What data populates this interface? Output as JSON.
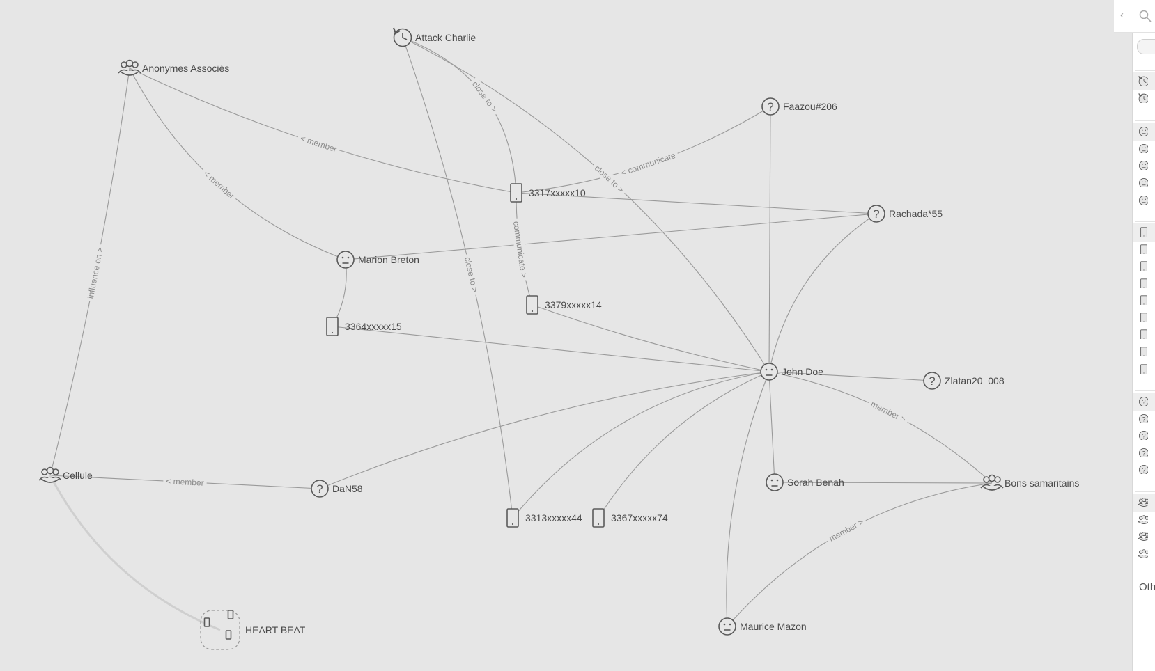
{
  "graph": {
    "nodes": [
      {
        "id": "attack",
        "label": "Attack Charlie",
        "icon": "history-clock-icon"
      },
      {
        "id": "anon",
        "label": "Anonymes Associés",
        "icon": "group-icon"
      },
      {
        "id": "faazou",
        "label": "Faazou#206",
        "icon": "question-icon"
      },
      {
        "id": "p3317",
        "label": "3317xxxxx10",
        "icon": "phone-icon"
      },
      {
        "id": "rachada",
        "label": "Rachada*55",
        "icon": "question-icon"
      },
      {
        "id": "marion",
        "label": "Marion Breton",
        "icon": "person-face-icon"
      },
      {
        "id": "p3379",
        "label": "3379xxxxx14",
        "icon": "phone-icon"
      },
      {
        "id": "p3364",
        "label": "3364xxxxx15",
        "icon": "phone-icon"
      },
      {
        "id": "john",
        "label": "John Doe",
        "icon": "person-face-icon"
      },
      {
        "id": "zlatan",
        "label": "Zlatan20_008",
        "icon": "question-icon"
      },
      {
        "id": "cellule",
        "label": "Cellule",
        "icon": "group-icon"
      },
      {
        "id": "dan",
        "label": "DaN58",
        "icon": "question-icon"
      },
      {
        "id": "sorah",
        "label": "Sorah Benah",
        "icon": "person-face-icon"
      },
      {
        "id": "bons",
        "label": "Bons samaritains",
        "icon": "group-icon"
      },
      {
        "id": "p3313",
        "label": "3313xxxxx44",
        "icon": "phone-icon"
      },
      {
        "id": "p3367",
        "label": "3367xxxxx74",
        "icon": "phone-icon"
      },
      {
        "id": "heart",
        "label": "HEART BEAT",
        "icon": "phone-cluster-icon"
      },
      {
        "id": "maurice",
        "label": "Maurice Mazon",
        "icon": "person-face-icon"
      }
    ],
    "edges": [
      {
        "from": "p3317",
        "to": "anon",
        "label": "< member"
      },
      {
        "from": "marion",
        "to": "anon",
        "label": "< member"
      },
      {
        "from": "cellule",
        "to": "anon",
        "label": "influence on >"
      },
      {
        "from": "attack",
        "to": "p3317",
        "label": "close to >"
      },
      {
        "from": "p3317",
        "to": "faazou",
        "label": "< communicate"
      },
      {
        "from": "p3317",
        "to": "p3379",
        "label": "communicate >"
      },
      {
        "from": "attack",
        "to": "john",
        "label": "close to >"
      },
      {
        "from": "attack",
        "to": "p3313",
        "label": "close to >"
      },
      {
        "from": "p3317",
        "to": "rachada",
        "label": ""
      },
      {
        "from": "marion",
        "to": "rachada",
        "label": ""
      },
      {
        "from": "marion",
        "to": "p3364",
        "label": ""
      },
      {
        "from": "faazou",
        "to": "john",
        "label": ""
      },
      {
        "from": "rachada",
        "to": "john",
        "label": ""
      },
      {
        "from": "p3379",
        "to": "john",
        "label": ""
      },
      {
        "from": "p3364",
        "to": "john",
        "label": ""
      },
      {
        "from": "john",
        "to": "zlatan",
        "label": ""
      },
      {
        "from": "dan",
        "to": "john",
        "label": ""
      },
      {
        "from": "p3313",
        "to": "john",
        "label": ""
      },
      {
        "from": "p3367",
        "to": "john",
        "label": ""
      },
      {
        "from": "john",
        "to": "sorah",
        "label": ""
      },
      {
        "from": "john",
        "to": "maurice",
        "label": ""
      },
      {
        "from": "john",
        "to": "bons",
        "label": "member >"
      },
      {
        "from": "maurice",
        "to": "bons",
        "label": "member >"
      },
      {
        "from": "sorah",
        "to": "bons",
        "label": ""
      },
      {
        "from": "dan",
        "to": "cellule",
        "label": "< member"
      },
      {
        "from": "cellule",
        "to": "heart",
        "label": ""
      }
    ]
  },
  "panel": {
    "collapse_icon": "chevron-left-icon",
    "search_icon": "search-icon",
    "other_label": "Oth"
  },
  "colors": {
    "background": "#e6e6e6",
    "edge": "#9a9a9a",
    "icon": "#5a5a5a",
    "text": "#4a4a4a"
  }
}
